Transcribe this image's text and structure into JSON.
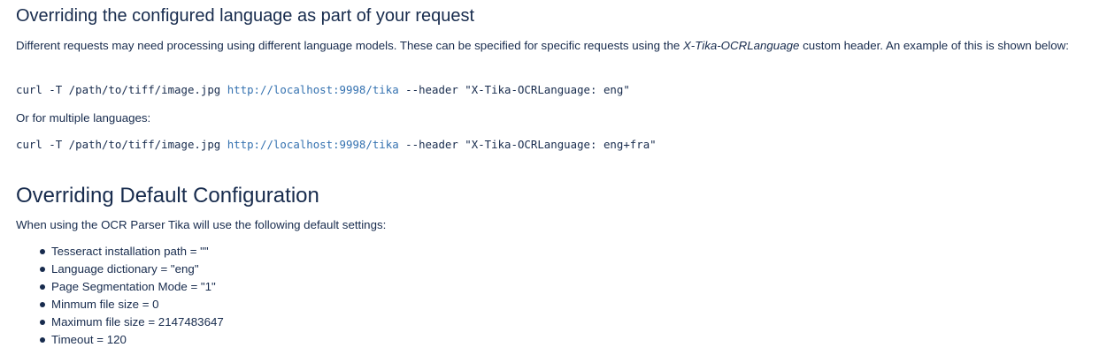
{
  "section1": {
    "title": "Overriding the configured language as part of your request",
    "intro_before": "Different requests may need processing using different language models. These can be specified for specific requests using the ",
    "intro_header": "X-Tika-OCRLanguage",
    "intro_after": " custom header. An example of this is shown below:",
    "code1": {
      "prefix": "curl -T /path/to/tiff/image.jpg ",
      "url": "http://localhost:9998/tika",
      "suffix": " --header \"X-Tika-OCRLanguage: eng\""
    },
    "or_multiple": "Or for multiple languages:",
    "code2": {
      "prefix": "curl -T /path/to/tiff/image.jpg ",
      "url": "http://localhost:9998/tika",
      "suffix": " --header \"X-Tika-OCRLanguage: eng+fra\""
    }
  },
  "section2": {
    "title": "Overriding Default Configuration",
    "intro": "When using the OCR Parser Tika will use the following default settings:",
    "items": [
      "Tesseract installation path = \"\"",
      "Language dictionary = \"eng\"",
      "Page Segmentation Mode = \"1\"",
      "Minmum file size = 0",
      "Maximum file size = 2147483647",
      "Timeout = 120"
    ]
  },
  "colors": {
    "text": "#172b4d",
    "link": "#3572b0",
    "background": "#ffffff"
  }
}
